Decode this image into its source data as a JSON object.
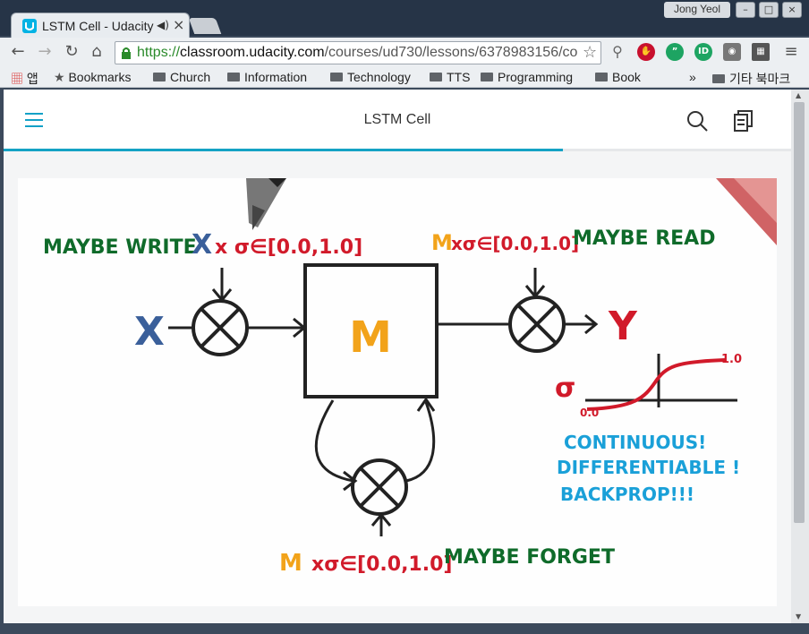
{
  "browser": {
    "tab_title": "LSTM Cell - Udacity",
    "tab_audio_icon": "speaker-icon",
    "user_name": "Jong Yeol",
    "url_scheme": "https://",
    "url_host": "classroom.udacity.com",
    "url_path": "/courses/ud730/lessons/6378983156/co",
    "bookmarks": {
      "apps": "앱",
      "items": [
        "Bookmarks",
        "Church",
        "Information",
        "Technology",
        "TTS",
        "Programming",
        "Book"
      ],
      "overflow": "»",
      "other": "기타 북마크"
    }
  },
  "page": {
    "title": "LSTM Cell",
    "progress_fraction": 0.71
  },
  "diagram": {
    "top_left_label": "MAYBE WRITE",
    "x_label": "X",
    "x_gate": "x σ∈[0.0,1.0]",
    "m_label": "M",
    "top_right_gate": "xσ∈[0.0,1.0]",
    "top_right_label": "MAYBE READ",
    "y_label": "Y",
    "sigma_label": "σ",
    "sigmoid_max": "1.0",
    "sigmoid_min": "0.0",
    "note_lines": [
      "CONTINUOUS!",
      "DIFFERENTIABLE !",
      "BACKPROP!!!"
    ],
    "bottom_gate": "xσ∈[0.0,1.0]",
    "bottom_label": "MAYBE FORGET"
  },
  "colors": {
    "accent": "#15a2c4",
    "green_text": "#0f6b2a",
    "red_text": "#d11a2a",
    "blue_text": "#3a5f9a",
    "orange_text": "#f2a31a",
    "cyan_text": "#1aa0d8"
  }
}
